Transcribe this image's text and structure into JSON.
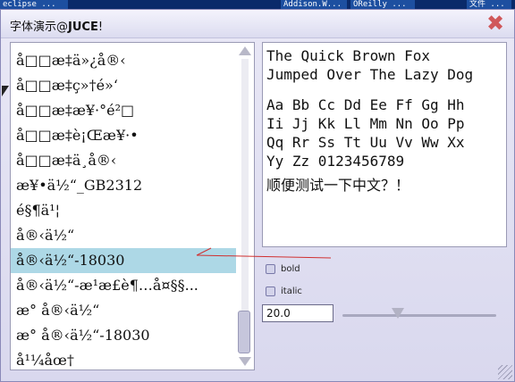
{
  "taskbar": {
    "items": [
      "eclipse ...",
      "Addison.W...",
      "OReilly ...",
      "文件 ..."
    ]
  },
  "window": {
    "title_prefix": "字体演示@",
    "title_brand": "JUCE",
    "title_suffix": "!",
    "close_glyph": "✖"
  },
  "font_list": {
    "items": [
      "å□□æ­‡ä»¿å®‹",
      "å□□æ­‡ç»†é»‘",
      "å□□æ­‡æ¥·°é²□",
      "å□□æ­‡è¡Œæ¥·•",
      "å□□æ­‡ä¸­å®‹",
      "æ¥•ä½“_GB2312",
      "é§¶ä¹¦",
      "å®‹ä½“",
      "å®‹ä½“-18030",
      "å®‹ä½“-æ¹æ£è¶…å¤§§...",
      "æ° å®‹ä½“",
      "æ° å®‹ä½“-18030",
      "å¹¼åœ†"
    ],
    "selected_index": 8
  },
  "preview": {
    "lines": [
      "The Quick Brown Fox",
      "Jumped Over The Lazy Dog",
      "",
      "Aa Bb Cc Dd Ee Ff Gg Hh",
      "Ii Jj Kk Ll Mm Nn Oo Pp",
      "Qq Rr Ss Tt Uu Vv Ww Xx",
      "Yy Zz 0123456789",
      "",
      "顺便测试一下中文？！"
    ]
  },
  "options": {
    "bold_label": "bold",
    "italic_label": "italic",
    "bold_checked": false,
    "italic_checked": false
  },
  "size": {
    "value": "20.0",
    "slider_fraction": 0.36
  },
  "colors": {
    "selected_row": "#add8e6",
    "close": "#d0585a",
    "annotation": "#d03030"
  }
}
